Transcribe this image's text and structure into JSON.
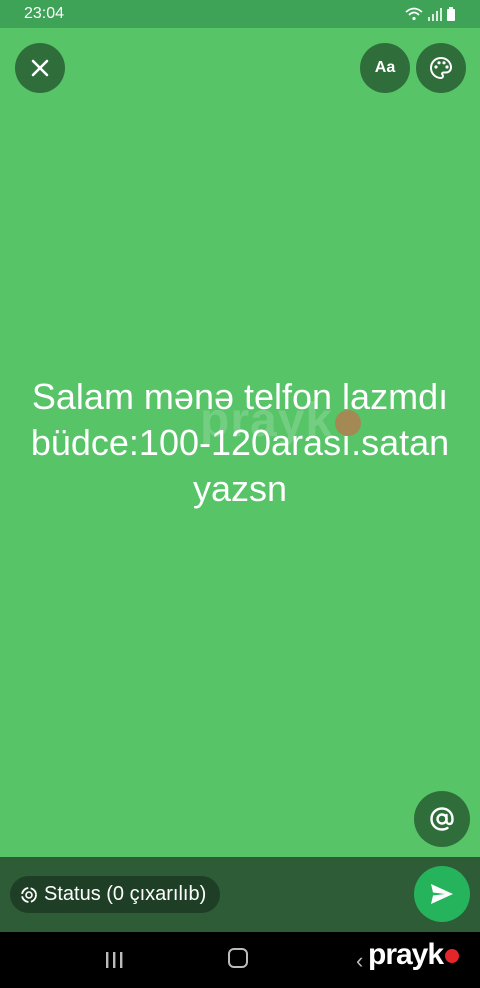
{
  "status_bar": {
    "time": "23:04"
  },
  "toolbar": {
    "close_icon": "close-icon",
    "font_label": "Aa",
    "palette_icon": "palette-icon"
  },
  "status": {
    "text": "Salam mənə telfon lazmdı\nbüdce:100-120arası.satan\nyazsn",
    "background_color": "#56c467"
  },
  "mention_icon": "at-icon",
  "audience_chip": {
    "label": "Status (0 çıxarılıb)"
  },
  "send_icon": "send-icon",
  "watermark": {
    "text": "prayk"
  }
}
